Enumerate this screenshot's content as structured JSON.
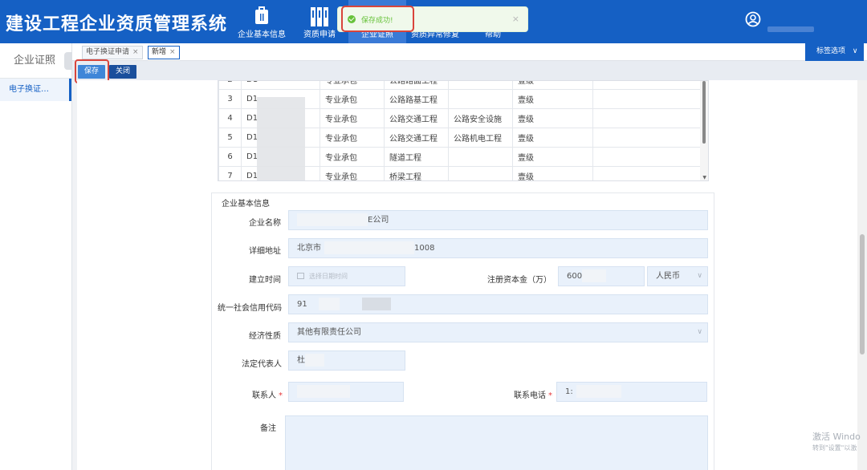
{
  "header": {
    "brand": "建设工程企业资质管理系统",
    "nav": [
      {
        "label": "企业基本信息",
        "icon": "briefcase-icon"
      },
      {
        "label": "资质申请",
        "icon": "books-icon"
      },
      {
        "label": "企业证照",
        "icon": "certificate-icon"
      },
      {
        "label": "资质异常修复",
        "icon": "repair-icon"
      },
      {
        "label": "帮助",
        "icon": "help-icon"
      }
    ],
    "user_icon": "user-circle-icon"
  },
  "toast": {
    "message": "保存成功!",
    "close": "×",
    "status_color": "#67c23a"
  },
  "sidebar": {
    "title": "企业证照",
    "item": "电子换证…"
  },
  "tabs": {
    "items": [
      {
        "label": "电子换证申请",
        "close": "×"
      },
      {
        "label": "新增",
        "close": "×"
      }
    ],
    "options_label": "标签选项",
    "options_arrow": "∨"
  },
  "toolbar": {
    "save": "保存",
    "close": "关闭"
  },
  "qualification_rows": [
    {
      "no": "3",
      "code": "D1",
      "category": "专业承包",
      "type": "公路路基工程",
      "sub": "",
      "level": "壹级"
    },
    {
      "no": "4",
      "code": "D1",
      "category": "专业承包",
      "type": "公路交通工程",
      "sub": "公路安全设施",
      "level": "壹级"
    },
    {
      "no": "5",
      "code": "D1",
      "category": "专业承包",
      "type": "公路交通工程",
      "sub": "公路机电工程",
      "level": "壹级"
    },
    {
      "no": "6",
      "code": "D1",
      "category": "专业承包",
      "type": "隧道工程",
      "sub": "",
      "level": "壹级"
    },
    {
      "no": "7",
      "code": "D1",
      "category": "专业承包",
      "type": "桥梁工程",
      "sub": "",
      "level": "壹级"
    }
  ],
  "form": {
    "legend": "企业基本信息",
    "company_name_label": "企业名称",
    "company_name_value": "E公司",
    "address_label": "详细地址",
    "address_city": "北京市",
    "address_number": "1008",
    "established_label": "建立时间",
    "established_placeholder": "选择日期时间",
    "capital_label": "注册资本金（万）",
    "capital_value": "600",
    "currency_value": "人民币",
    "credit_code_label": "统一社会信用代码",
    "credit_code_value": "91",
    "economic_nature_label": "经济性质",
    "economic_nature_value": "其他有限责任公司",
    "legal_rep_label": "法定代表人",
    "legal_rep_value": "杜",
    "contact_label": "联系人",
    "phone_label": "联系电话",
    "phone_value": "1:",
    "remark_label": "备注",
    "required_mark": "*"
  },
  "watermark": {
    "line1": "激活 Windo",
    "line2": "转到\"设置\"以激"
  }
}
